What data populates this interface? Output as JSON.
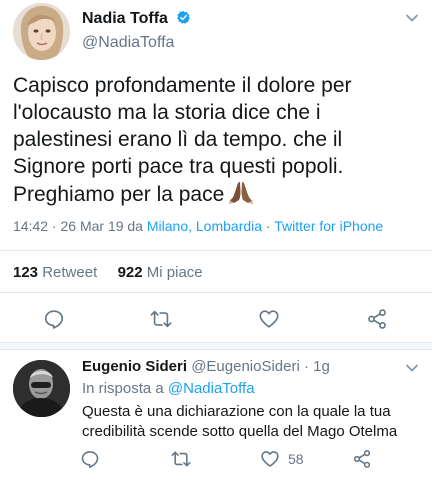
{
  "tweet": {
    "author_name": "Nadia Toffa",
    "author_handle": "@NadiaToffa",
    "text_lines": [
      "Capisco profondamente il dolore per",
      "l'olocausto ma la storia dice che i",
      "palestinesi erano  lì da tempo. che il",
      "Signore porti pace tra questi popoli.",
      "Preghiamo per la pace"
    ],
    "time_prefix": "14:42 · 26 Mar 19 da ",
    "location": "Milano, Lombardia",
    "separator": " · ",
    "source": "Twitter for iPhone",
    "retweet_count": "123",
    "retweet_label": "Retweet",
    "like_count": "922",
    "like_label": "Mi piace"
  },
  "reply": {
    "author_name": "Eugenio Sideri",
    "author_handle": "@EugenioSideri",
    "time": " · 1g",
    "in_reply_prefix": "In risposta a ",
    "in_reply_handle": "@NadiaToffa",
    "text_lines": [
      "Questa è una dichiarazione con la quale la tua",
      "credibilità scende sotto quella del Mago Otelma"
    ],
    "like_count": "58"
  },
  "colors": {
    "accent": "#1da1f2",
    "secondary_text": "#657786",
    "primary_text": "#14171a",
    "icon": "#657786"
  },
  "icons": [
    "verified-badge-icon",
    "chevron-down-icon",
    "reply-icon",
    "retweet-icon",
    "like-icon",
    "share-icon",
    "folded-hands-emoji"
  ]
}
